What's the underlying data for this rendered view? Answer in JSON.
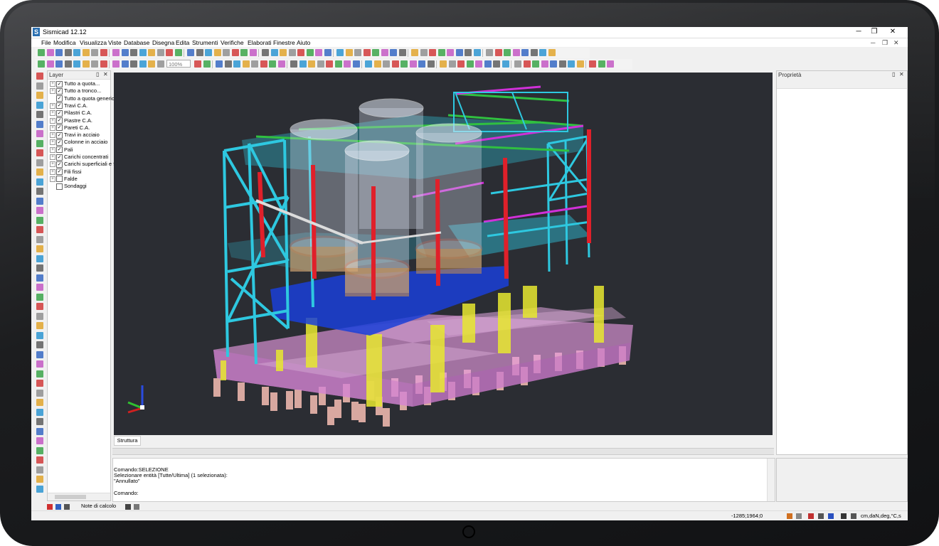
{
  "window": {
    "title": "Sismicad 12.12",
    "icon_letter": "S",
    "minimize": "─",
    "maximize": "❐",
    "close": "✕"
  },
  "menu": [
    "File",
    "Modifica",
    "Visualizza",
    "Viste",
    "Database",
    "Disegna",
    "Edita",
    "Strumenti",
    "Verifiche",
    "Elaborati",
    "Finestre",
    "Aiuto"
  ],
  "mdi_buttons": [
    "─",
    "❐",
    "✕"
  ],
  "toolbar": {
    "zoom_value": "100%"
  },
  "layer_panel": {
    "title": "Layer",
    "pin": "▯",
    "close": "✕",
    "items": [
      {
        "label": "Tutto a quota...",
        "checked": true,
        "expand": true
      },
      {
        "label": "Tutto a tronco...",
        "checked": true,
        "expand": true
      },
      {
        "label": "Tutto a quota generica",
        "checked": true,
        "expand": false
      },
      {
        "label": "Travi C.A.",
        "checked": true,
        "expand": true
      },
      {
        "label": "Pilastri C.A.",
        "checked": true,
        "expand": true
      },
      {
        "label": "Piastre C.A.",
        "checked": true,
        "expand": true
      },
      {
        "label": "Pareti C.A.",
        "checked": true,
        "expand": true
      },
      {
        "label": "Travi in acciaio",
        "checked": true,
        "expand": true
      },
      {
        "label": "Colonne in acciaio",
        "checked": true,
        "expand": true
      },
      {
        "label": "Pali",
        "checked": true,
        "expand": true
      },
      {
        "label": "Carichi concentrati",
        "checked": true,
        "expand": true
      },
      {
        "label": "Carichi superficiali e fi",
        "checked": true,
        "expand": true
      },
      {
        "label": "Fili fissi",
        "checked": true,
        "expand": true
      },
      {
        "label": "Falde",
        "checked": false,
        "expand": true
      },
      {
        "label": "Sondaggi",
        "checked": false,
        "expand": false
      }
    ]
  },
  "viewport": {
    "tab_label": "Struttura"
  },
  "command": {
    "lines": [
      "Comando:SELEZIONE",
      "Selezionare entità [Tutte/Ultima] (1 selezionata):",
      "  \"Annullato\"",
      "",
      "Comando:"
    ]
  },
  "properties": {
    "title": "Proprietà",
    "pin": "▯",
    "close": "✕"
  },
  "statusbar": {
    "left_label": "Note di calcolo",
    "coordinates": "-1285;1964;0",
    "units": "cm,daN,deg,°C,s"
  },
  "colors": {
    "viewport_bg": "#2b2d33",
    "steel_cyan": "#2ec8e0",
    "column_red": "#e0202a",
    "slab_blue": "#1a3fd8",
    "foundation_pink": "#e79ae0",
    "pier_yellow": "#e8e830",
    "pile_salmon": "#d8a8a0",
    "beam_magenta": "#d030d8",
    "beam_green": "#30c040"
  }
}
